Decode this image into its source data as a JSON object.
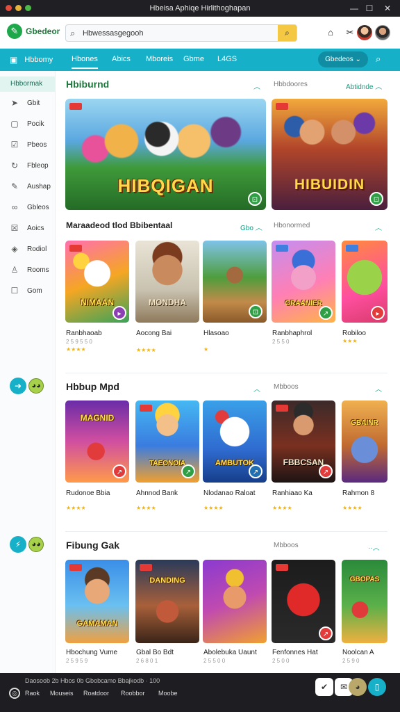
{
  "window": {
    "title": "Hbeisa Aphiqe Hirlithoghapan",
    "controls": {
      "minimize": "—",
      "maximize": "☐",
      "close": "✕"
    },
    "dot_colors": [
      "#e24c3d",
      "#e8b33a",
      "#4cb948"
    ]
  },
  "header": {
    "logo_text": "Gbedeor",
    "logo_icon": "leaf-icon",
    "search": {
      "value": "Hbwessasgegooh",
      "placeholder": ""
    }
  },
  "navbar": {
    "app_label": "Hbbomy",
    "tabs": [
      "Hbones",
      "Abics",
      "Mboreis",
      "Gbme",
      "L4GS"
    ],
    "active_tab": 0,
    "dropdown_label": "Gbedeos"
  },
  "sidebar": {
    "active_label": "Hbbormak",
    "items": [
      {
        "label": "Gbit",
        "icon": "send-icon"
      },
      {
        "label": "Pocik",
        "icon": "book-icon"
      },
      {
        "label": "Pbeos",
        "icon": "checkbox-icon"
      },
      {
        "label": "Fbleop",
        "icon": "refresh-icon"
      },
      {
        "label": "Aushap",
        "icon": "pen-icon"
      },
      {
        "label": "Gbleos",
        "icon": "glasses-icon"
      },
      {
        "label": "Aoics",
        "icon": "list-icon"
      },
      {
        "label": "Rodiol",
        "icon": "shield-icon"
      },
      {
        "label": "Rooms",
        "icon": "user-icon"
      },
      {
        "label": "Gom",
        "icon": "bag-icon"
      }
    ]
  },
  "featured": {
    "title": "Hbiburnd",
    "label": "Hbbdoores",
    "link": "Abtidnde",
    "banners": [
      {
        "title": "HIBQIGAN"
      },
      {
        "title": "HIBUIDIN"
      }
    ]
  },
  "section_1": {
    "title": "Maraadeod tlod Bbibentaal",
    "link": "Gbo",
    "label": "Hbonormed",
    "cards": [
      {
        "art": "NIMAAN",
        "name": "Ranbhaoab",
        "meta": "2 5 9 5 5 0",
        "stars": "★★★★",
        "badge_color": "#8b3fb2"
      },
      {
        "art": "MONDHA",
        "name": "Aocong Bai",
        "meta": "",
        "stars": "★★★★",
        "badge_color": ""
      },
      {
        "art": "",
        "name": "Hlasoao",
        "meta": "",
        "stars": "★",
        "badge_color": "#2f9e44"
      },
      {
        "art": "GRAANIER",
        "name": "Ranbhaphrol",
        "meta": "2 5 5 0",
        "stars": "",
        "badge_color": "#2f9e44"
      },
      {
        "art": "",
        "name": "Robiloo",
        "meta": "",
        "stars": "★★★",
        "badge_color": "#e23b3b"
      }
    ]
  },
  "section_2": {
    "title": "Hbbup Mpd",
    "label": "Mbboos",
    "cards": [
      {
        "art": "MAGNID",
        "name": "Rudonoe Bbia",
        "stars": "★★★★",
        "badge_color": "#e23b3b"
      },
      {
        "art": "TAEONOIA",
        "name": "Ahnnod Bank",
        "stars": "★★★★",
        "badge_color": "#2f9e44"
      },
      {
        "art": "AMBUTOK",
        "name": "Nlodanao Raloat",
        "stars": "★★★★",
        "badge_color": "#1f6fb2"
      },
      {
        "art": "FBBCSAN",
        "name": "Ranhiaao Ka",
        "stars": "★★★★",
        "badge_color": "#e23b3b"
      },
      {
        "art": "GBAINR",
        "name": "Rahmon 8",
        "stars": "★★★★",
        "badge_color": ""
      }
    ]
  },
  "section_3": {
    "title": "Fibung Gak",
    "label": "Mbboos",
    "cards": [
      {
        "art": "GAMAMAN",
        "name": "Hbochung Vume",
        "meta": "2 5 9 5 9",
        "badge_color": ""
      },
      {
        "art": "DANDING",
        "name": "Gbal Bo Bdt",
        "meta": "2 6 8 0 1",
        "badge_color": ""
      },
      {
        "art": "",
        "name": "Abolebuka Uaunt",
        "meta": "2 5 5 0 0",
        "badge_color": ""
      },
      {
        "art": "",
        "name": "Fenfonnes Hat",
        "meta": "2 5 0 0",
        "badge_color": "#e23b3b"
      },
      {
        "art": "GBOPAS",
        "name": "Noolcan A",
        "meta": "2 5 9 0",
        "badge_color": ""
      }
    ]
  },
  "bottombar": {
    "status_text": "Daosoob 2b Hbos 0b Gbobcamo Bbajkodb · 100",
    "nav": [
      "Raok",
      "Mouseis",
      "Roatdoor",
      "Roobbor",
      "Moobe"
    ]
  }
}
